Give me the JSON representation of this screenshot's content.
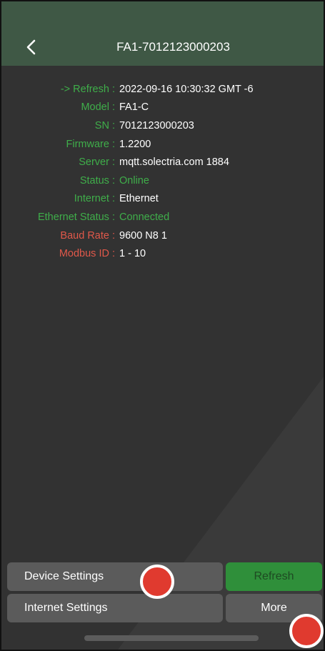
{
  "header": {
    "title": "FA1-7012123000203",
    "back_icon": "chevron-left-icon"
  },
  "info": [
    {
      "label": "-> Refresh :",
      "value": "2022-09-16 10:30:32 GMT -6",
      "label_color": "green",
      "value_color": "white"
    },
    {
      "label": "Model :",
      "value": "FA1-C",
      "label_color": "green",
      "value_color": "white"
    },
    {
      "label": "SN :",
      "value": "7012123000203",
      "label_color": "green",
      "value_color": "white"
    },
    {
      "label": "Firmware :",
      "value": "1.2200",
      "label_color": "green",
      "value_color": "white"
    },
    {
      "label": "Server :",
      "value": "mqtt.solectria.com 1884",
      "label_color": "green",
      "value_color": "white"
    },
    {
      "label": "Status :",
      "value": "Online",
      "label_color": "green",
      "value_color": "green"
    },
    {
      "label": "Internet :",
      "value": "Ethernet",
      "label_color": "green",
      "value_color": "white"
    },
    {
      "label": "Ethernet Status :",
      "value": "Connected",
      "label_color": "green",
      "value_color": "green"
    },
    {
      "label": "Baud Rate :",
      "value": "9600 N8 1",
      "label_color": "red",
      "value_color": "white"
    },
    {
      "label": "Modbus ID :",
      "value": "1 - 10",
      "label_color": "red",
      "value_color": "white"
    }
  ],
  "buttons": {
    "device_settings": "Device Settings",
    "refresh": "Refresh",
    "internet_settings": "Internet Settings",
    "more": "More"
  },
  "colors": {
    "header_bg": "#3f5845",
    "background": "#323232",
    "label_green": "#3fae4a",
    "label_red": "#e0584a",
    "button_gray": "#5b5b5b",
    "button_green": "#2f8f3a",
    "marker_red": "#e03a2f"
  }
}
